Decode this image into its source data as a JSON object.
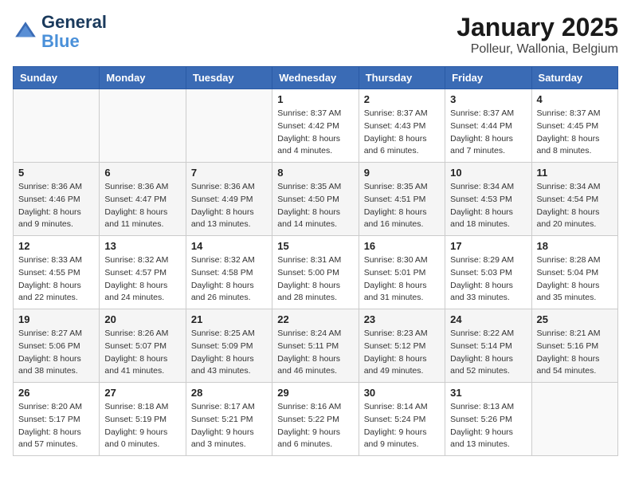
{
  "header": {
    "logo_line1": "General",
    "logo_line2": "Blue",
    "title": "January 2025",
    "subtitle": "Polleur, Wallonia, Belgium"
  },
  "calendar": {
    "days_of_week": [
      "Sunday",
      "Monday",
      "Tuesday",
      "Wednesday",
      "Thursday",
      "Friday",
      "Saturday"
    ],
    "weeks": [
      [
        {
          "day": "",
          "sunrise": "",
          "sunset": "",
          "daylight": ""
        },
        {
          "day": "",
          "sunrise": "",
          "sunset": "",
          "daylight": ""
        },
        {
          "day": "",
          "sunrise": "",
          "sunset": "",
          "daylight": ""
        },
        {
          "day": "1",
          "sunrise": "Sunrise: 8:37 AM",
          "sunset": "Sunset: 4:42 PM",
          "daylight": "Daylight: 8 hours and 4 minutes."
        },
        {
          "day": "2",
          "sunrise": "Sunrise: 8:37 AM",
          "sunset": "Sunset: 4:43 PM",
          "daylight": "Daylight: 8 hours and 6 minutes."
        },
        {
          "day": "3",
          "sunrise": "Sunrise: 8:37 AM",
          "sunset": "Sunset: 4:44 PM",
          "daylight": "Daylight: 8 hours and 7 minutes."
        },
        {
          "day": "4",
          "sunrise": "Sunrise: 8:37 AM",
          "sunset": "Sunset: 4:45 PM",
          "daylight": "Daylight: 8 hours and 8 minutes."
        }
      ],
      [
        {
          "day": "5",
          "sunrise": "Sunrise: 8:36 AM",
          "sunset": "Sunset: 4:46 PM",
          "daylight": "Daylight: 8 hours and 9 minutes."
        },
        {
          "day": "6",
          "sunrise": "Sunrise: 8:36 AM",
          "sunset": "Sunset: 4:47 PM",
          "daylight": "Daylight: 8 hours and 11 minutes."
        },
        {
          "day": "7",
          "sunrise": "Sunrise: 8:36 AM",
          "sunset": "Sunset: 4:49 PM",
          "daylight": "Daylight: 8 hours and 13 minutes."
        },
        {
          "day": "8",
          "sunrise": "Sunrise: 8:35 AM",
          "sunset": "Sunset: 4:50 PM",
          "daylight": "Daylight: 8 hours and 14 minutes."
        },
        {
          "day": "9",
          "sunrise": "Sunrise: 8:35 AM",
          "sunset": "Sunset: 4:51 PM",
          "daylight": "Daylight: 8 hours and 16 minutes."
        },
        {
          "day": "10",
          "sunrise": "Sunrise: 8:34 AM",
          "sunset": "Sunset: 4:53 PM",
          "daylight": "Daylight: 8 hours and 18 minutes."
        },
        {
          "day": "11",
          "sunrise": "Sunrise: 8:34 AM",
          "sunset": "Sunset: 4:54 PM",
          "daylight": "Daylight: 8 hours and 20 minutes."
        }
      ],
      [
        {
          "day": "12",
          "sunrise": "Sunrise: 8:33 AM",
          "sunset": "Sunset: 4:55 PM",
          "daylight": "Daylight: 8 hours and 22 minutes."
        },
        {
          "day": "13",
          "sunrise": "Sunrise: 8:32 AM",
          "sunset": "Sunset: 4:57 PM",
          "daylight": "Daylight: 8 hours and 24 minutes."
        },
        {
          "day": "14",
          "sunrise": "Sunrise: 8:32 AM",
          "sunset": "Sunset: 4:58 PM",
          "daylight": "Daylight: 8 hours and 26 minutes."
        },
        {
          "day": "15",
          "sunrise": "Sunrise: 8:31 AM",
          "sunset": "Sunset: 5:00 PM",
          "daylight": "Daylight: 8 hours and 28 minutes."
        },
        {
          "day": "16",
          "sunrise": "Sunrise: 8:30 AM",
          "sunset": "Sunset: 5:01 PM",
          "daylight": "Daylight: 8 hours and 31 minutes."
        },
        {
          "day": "17",
          "sunrise": "Sunrise: 8:29 AM",
          "sunset": "Sunset: 5:03 PM",
          "daylight": "Daylight: 8 hours and 33 minutes."
        },
        {
          "day": "18",
          "sunrise": "Sunrise: 8:28 AM",
          "sunset": "Sunset: 5:04 PM",
          "daylight": "Daylight: 8 hours and 35 minutes."
        }
      ],
      [
        {
          "day": "19",
          "sunrise": "Sunrise: 8:27 AM",
          "sunset": "Sunset: 5:06 PM",
          "daylight": "Daylight: 8 hours and 38 minutes."
        },
        {
          "day": "20",
          "sunrise": "Sunrise: 8:26 AM",
          "sunset": "Sunset: 5:07 PM",
          "daylight": "Daylight: 8 hours and 41 minutes."
        },
        {
          "day": "21",
          "sunrise": "Sunrise: 8:25 AM",
          "sunset": "Sunset: 5:09 PM",
          "daylight": "Daylight: 8 hours and 43 minutes."
        },
        {
          "day": "22",
          "sunrise": "Sunrise: 8:24 AM",
          "sunset": "Sunset: 5:11 PM",
          "daylight": "Daylight: 8 hours and 46 minutes."
        },
        {
          "day": "23",
          "sunrise": "Sunrise: 8:23 AM",
          "sunset": "Sunset: 5:12 PM",
          "daylight": "Daylight: 8 hours and 49 minutes."
        },
        {
          "day": "24",
          "sunrise": "Sunrise: 8:22 AM",
          "sunset": "Sunset: 5:14 PM",
          "daylight": "Daylight: 8 hours and 52 minutes."
        },
        {
          "day": "25",
          "sunrise": "Sunrise: 8:21 AM",
          "sunset": "Sunset: 5:16 PM",
          "daylight": "Daylight: 8 hours and 54 minutes."
        }
      ],
      [
        {
          "day": "26",
          "sunrise": "Sunrise: 8:20 AM",
          "sunset": "Sunset: 5:17 PM",
          "daylight": "Daylight: 8 hours and 57 minutes."
        },
        {
          "day": "27",
          "sunrise": "Sunrise: 8:18 AM",
          "sunset": "Sunset: 5:19 PM",
          "daylight": "Daylight: 9 hours and 0 minutes."
        },
        {
          "day": "28",
          "sunrise": "Sunrise: 8:17 AM",
          "sunset": "Sunset: 5:21 PM",
          "daylight": "Daylight: 9 hours and 3 minutes."
        },
        {
          "day": "29",
          "sunrise": "Sunrise: 8:16 AM",
          "sunset": "Sunset: 5:22 PM",
          "daylight": "Daylight: 9 hours and 6 minutes."
        },
        {
          "day": "30",
          "sunrise": "Sunrise: 8:14 AM",
          "sunset": "Sunset: 5:24 PM",
          "daylight": "Daylight: 9 hours and 9 minutes."
        },
        {
          "day": "31",
          "sunrise": "Sunrise: 8:13 AM",
          "sunset": "Sunset: 5:26 PM",
          "daylight": "Daylight: 9 hours and 13 minutes."
        },
        {
          "day": "",
          "sunrise": "",
          "sunset": "",
          "daylight": ""
        }
      ]
    ]
  }
}
